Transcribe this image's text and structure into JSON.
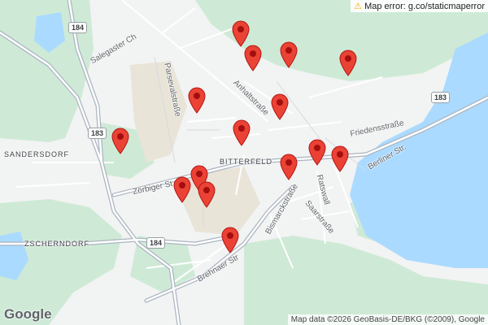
{
  "error_banner": {
    "icon": "warning-icon",
    "text": "Map error: g.co/staticmaperror"
  },
  "attribution": "Map data ©2026 GeoBasis-DE/BKG (©2009), Google",
  "logo": "Google",
  "labels": {
    "sandersdorf": "SANDERSDORF",
    "zscherndorf": "ZSCHERNDORF",
    "bitterfeld": "BITTERFELD",
    "salegaster": "Salegaster Ch",
    "parsevalstrasse": "Parsevalstraße",
    "anhaltstrasse": "Anhaltstraße",
    "friedensstrasse": "Friedensstraße",
    "berliner_str": "Berliner Str.",
    "zoerbiger": "Zörbiger St",
    "bismarckstrasse": "Bismarckstraße",
    "ratswall": "Ratswall",
    "saarstrasse": "Saarstraße",
    "brehnaer": "Brehnaer Str"
  },
  "shields": {
    "road_184_top": "184",
    "road_183_left": "183",
    "road_183_right": "183",
    "road_184_bottom": "184"
  },
  "colors": {
    "pin": "#ea4335",
    "pin_dot": "#a50e0e",
    "water": "#aadaff",
    "green": "#ceead6",
    "road": "#ffffff",
    "major_road": "#aab4c0"
  },
  "markers": [
    {
      "name": "marker-1"
    },
    {
      "name": "marker-2"
    },
    {
      "name": "marker-3"
    },
    {
      "name": "marker-4"
    },
    {
      "name": "marker-5"
    },
    {
      "name": "marker-6"
    },
    {
      "name": "marker-7"
    },
    {
      "name": "marker-8"
    },
    {
      "name": "marker-9"
    },
    {
      "name": "marker-10"
    },
    {
      "name": "marker-11"
    },
    {
      "name": "marker-12"
    },
    {
      "name": "marker-13"
    },
    {
      "name": "marker-14"
    },
    {
      "name": "marker-15"
    }
  ]
}
